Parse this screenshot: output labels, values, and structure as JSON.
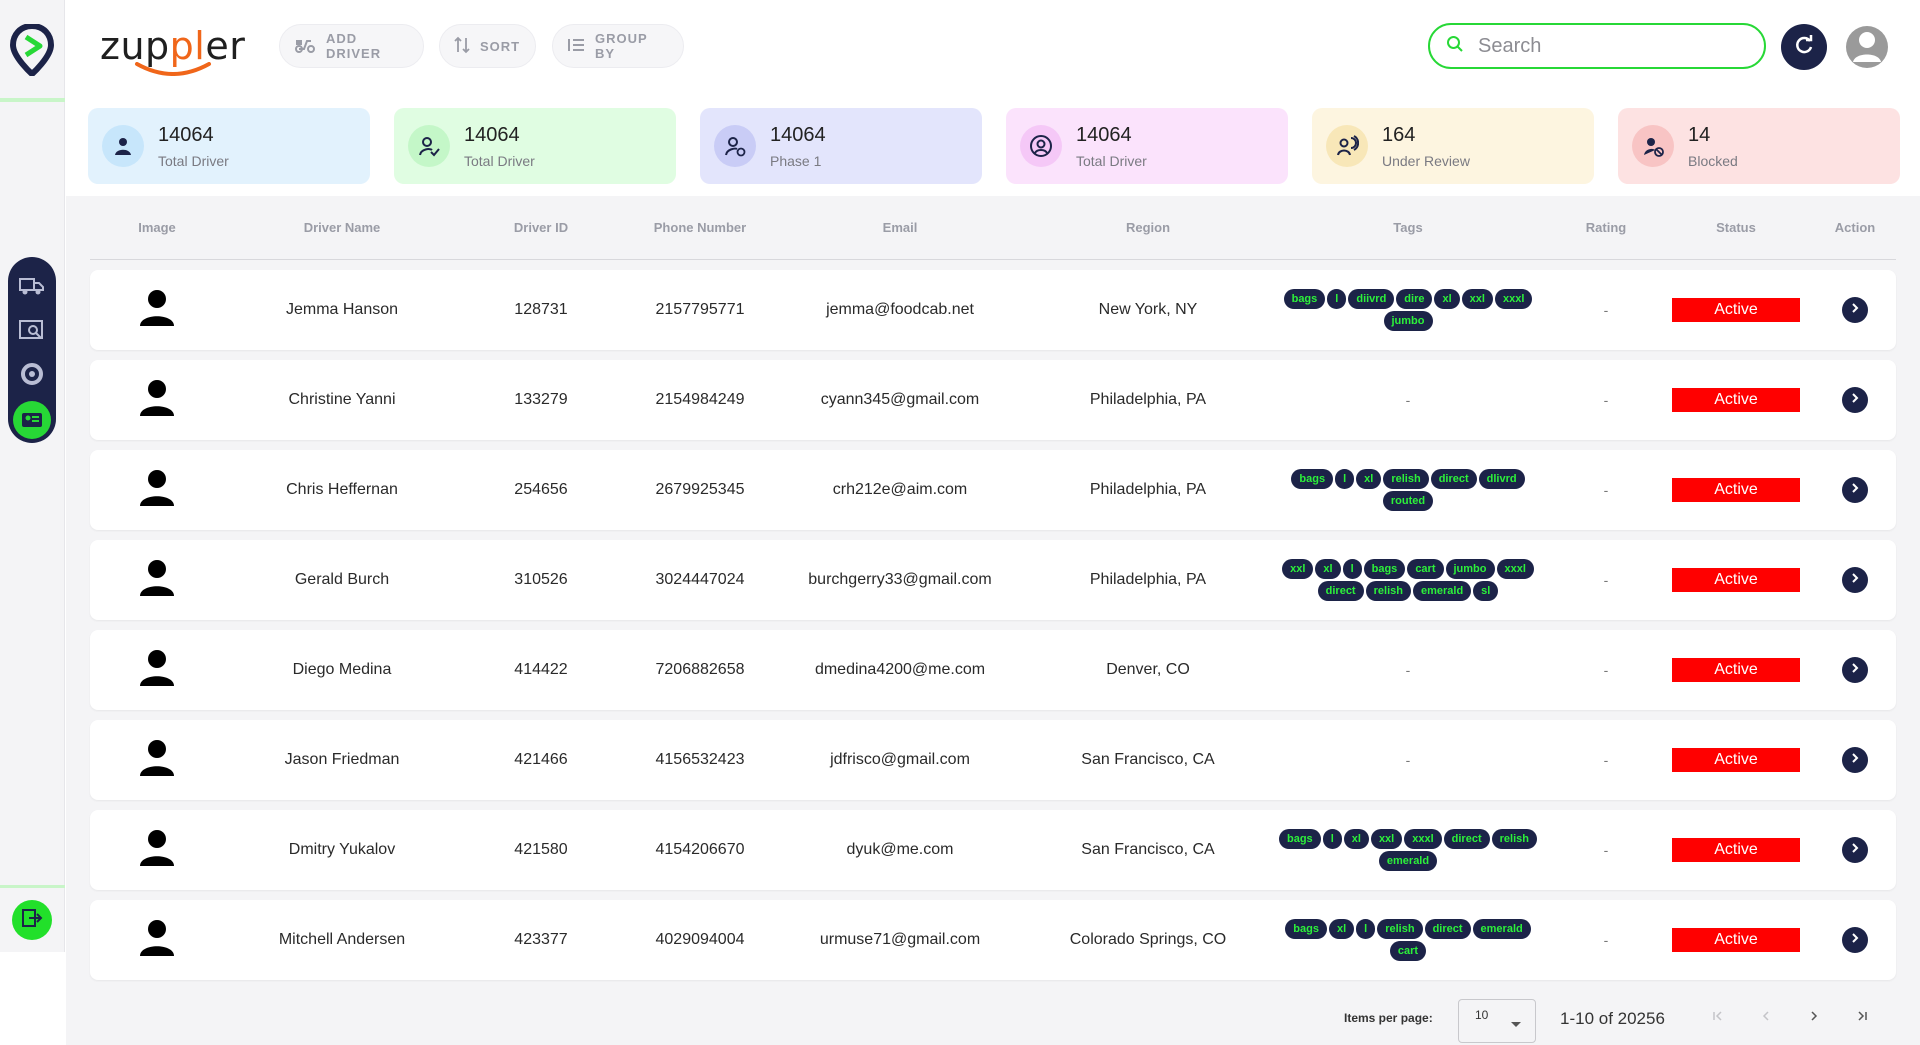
{
  "brand": {
    "name_start": "zup",
    "name_accent": "pl",
    "name_end": "er"
  },
  "toolbar": {
    "add_driver": "ADD DRIVER",
    "sort": "SORT",
    "group_by": "GROUP BY"
  },
  "search": {
    "placeholder": "Search",
    "value": ""
  },
  "stats": [
    {
      "value": "14064",
      "label": "Total Driver",
      "bg": "#e2f2fd",
      "icon_bg": "#c7e6fb",
      "icon": "person-icon"
    },
    {
      "value": "14064",
      "label": "Total Driver",
      "bg": "#e0fde2",
      "icon_bg": "#c4f7c8",
      "icon": "person-check-icon"
    },
    {
      "value": "14064",
      "label": "Phase 1",
      "bg": "#e3e5fc",
      "icon_bg": "#c9ccf6",
      "icon": "person-sync-icon"
    },
    {
      "value": "14064",
      "label": "Total Driver",
      "bg": "#fbe3fc",
      "icon_bg": "#f5c8f7",
      "icon": "account-circle-icon"
    },
    {
      "value": "164",
      "label": "Under Review",
      "bg": "#fdf5e0",
      "icon_bg": "#f8e7b8",
      "icon": "review-icon"
    },
    {
      "value": "14",
      "label": "Blocked",
      "bg": "#fde2e2",
      "icon_bg": "#f8c4c4",
      "icon": "person-block-icon"
    }
  ],
  "table": {
    "headers": [
      "Image",
      "Driver Name",
      "Driver ID",
      "Phone Number",
      "Email",
      "Region",
      "Tags",
      "Rating",
      "Status",
      "Action"
    ],
    "rows": [
      {
        "name": "Jemma Hanson",
        "id": "128731",
        "phone": "2157795771",
        "email": "jemma@foodcab.net",
        "region": "New York, NY",
        "tags": [
          "bags",
          "l",
          "diivrd",
          "dire",
          "xl",
          "xxl",
          "xxxl",
          "jumbo"
        ],
        "rating": "-",
        "status": "Active"
      },
      {
        "name": "Christine Yanni",
        "id": "133279",
        "phone": "2154984249",
        "email": "cyann345@gmail.com",
        "region": "Philadelphia, PA",
        "tags": [],
        "tags_empty": "-",
        "rating": "-",
        "status": "Active"
      },
      {
        "name": "Chris Heffernan",
        "id": "254656",
        "phone": "2679925345",
        "email": "crh212e@aim.com",
        "region": "Philadelphia, PA",
        "tags": [
          "bags",
          "l",
          "xl",
          "relish",
          "direct",
          "dlivrd",
          "routed"
        ],
        "rating": "-",
        "status": "Active"
      },
      {
        "name": "Gerald Burch",
        "id": "310526",
        "phone": "3024447024",
        "email": "burchgerry33@gmail.com",
        "region": "Philadelphia, PA",
        "tags": [
          "xxl",
          "xl",
          "l",
          "bags",
          "cart",
          "jumbo",
          "xxxl",
          "direct",
          "relish",
          "emerald",
          "sl"
        ],
        "rating": "-",
        "status": "Active"
      },
      {
        "name": "Diego Medina",
        "id": "414422",
        "phone": "7206882658",
        "email": "dmedina4200@me.com",
        "region": "Denver, CO",
        "tags": [],
        "tags_empty": "-",
        "rating": "-",
        "status": "Active"
      },
      {
        "name": "Jason Friedman",
        "id": "421466",
        "phone": "4156532423",
        "email": "jdfrisco@gmail.com",
        "region": "San Francisco, CA",
        "tags": [],
        "tags_empty": "-",
        "rating": "-",
        "status": "Active"
      },
      {
        "name": "Dmitry Yukalov",
        "id": "421580",
        "phone": "4154206670",
        "email": "dyuk@me.com",
        "region": "San Francisco, CA",
        "tags": [
          "bags",
          "l",
          "xl",
          "xxl",
          "xxxl",
          "direct",
          "relish",
          "emerald"
        ],
        "rating": "-",
        "status": "Active"
      },
      {
        "name": "Mitchell Andersen",
        "id": "423377",
        "phone": "4029094004",
        "email": "urmuse71@gmail.com",
        "region": "Colorado Springs, CO",
        "tags": [
          "bags",
          "xl",
          "l",
          "relish",
          "direct",
          "emerald",
          "cart"
        ],
        "rating": "-",
        "status": "Active"
      }
    ]
  },
  "pagination": {
    "items_per_page_label": "Items per page:",
    "items_per_page": "10",
    "range": "1-10 of 20256"
  },
  "colors": {
    "accent_green": "#27d836",
    "navy": "#1c2348",
    "status_red": "#ff0000",
    "brand_orange": "#f0661a"
  }
}
